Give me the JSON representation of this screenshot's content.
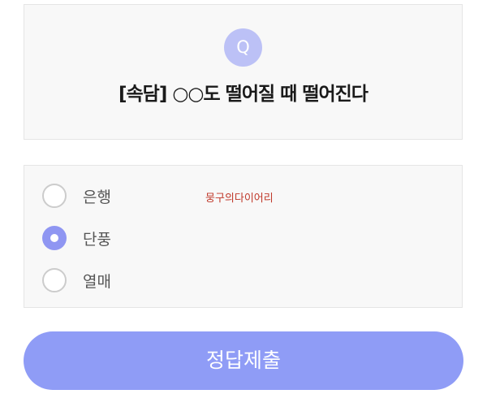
{
  "question": {
    "badge": "Q",
    "text": "[속담] ○○도 떨어질 때 떨어진다"
  },
  "options": [
    {
      "label": "은행",
      "selected": false
    },
    {
      "label": "단풍",
      "selected": true
    },
    {
      "label": "열매",
      "selected": false
    }
  ],
  "watermark": "뭉구의다이어리",
  "submit": {
    "label": "정답제출"
  },
  "colors": {
    "accent": "#8f9cf6",
    "badge": "#bcc1f6",
    "watermark": "#c0392b"
  }
}
